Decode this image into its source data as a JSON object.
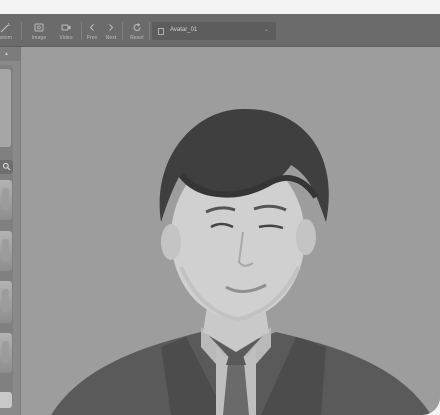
{
  "toolbar": {
    "items": [
      {
        "label": "ustom",
        "icon": "magic-wand-icon"
      },
      {
        "label": "Image",
        "icon": "image-icon"
      },
      {
        "label": "Video",
        "icon": "video-camera-icon"
      },
      {
        "label": "Prev",
        "icon": "chevron-left-icon"
      },
      {
        "label": "Next",
        "icon": "chevron-right-icon"
      },
      {
        "label": "Reset",
        "icon": "reset-icon"
      }
    ],
    "avatar_select": {
      "value": "Avatar_01",
      "icon": "avatar-square-icon"
    }
  },
  "left_panel": {
    "up_icon": "chevron-up-icon",
    "search_icon": "search-icon"
  },
  "colors": {
    "toolbar_bg": "#6b6b6b",
    "viewport_bg": "#9d9d9d",
    "panel_bg": "#8a8a8a"
  }
}
